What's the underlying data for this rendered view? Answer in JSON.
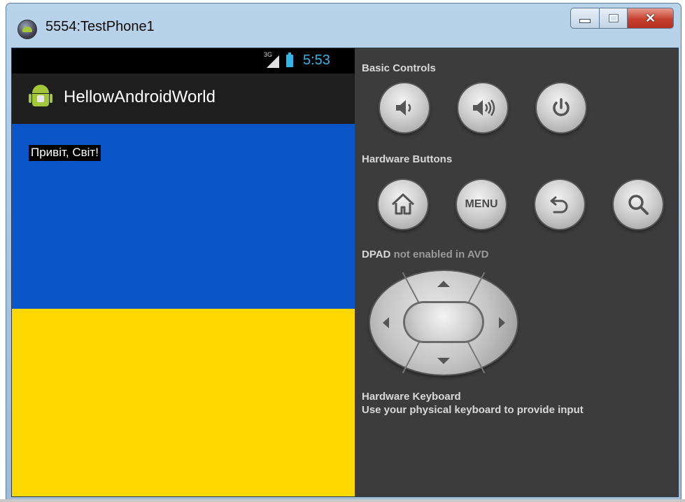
{
  "window": {
    "title": "5554:TestPhone1",
    "buttons": {
      "minimize": "minimize",
      "maximize": "maximize",
      "close": "close"
    }
  },
  "phone": {
    "status_bar": {
      "network": "3G",
      "time": "5:53"
    },
    "action_bar": {
      "app_name": "HellowAndroidWorld"
    },
    "content": {
      "greeting": "Привіт, Світ!"
    },
    "colors": {
      "flag_blue": "#0a56c8",
      "flag_yellow": "#ffd800",
      "accent": "#33b5e5",
      "android_green": "#a4c639"
    }
  },
  "controls": {
    "basic_controls_label": "Basic Controls",
    "basic_buttons": [
      "volume-down-icon",
      "volume-up-icon",
      "power-icon"
    ],
    "hardware_buttons_label": "Hardware Buttons",
    "hardware_buttons": [
      "home-icon",
      "menu-button",
      "back-icon",
      "search-icon"
    ],
    "menu_label": "MENU",
    "dpad_label_strong": "DPAD",
    "dpad_label_dim": "not enabled in AVD",
    "keyboard_title": "Hardware Keyboard",
    "keyboard_hint": "Use your physical keyboard to provide input"
  }
}
